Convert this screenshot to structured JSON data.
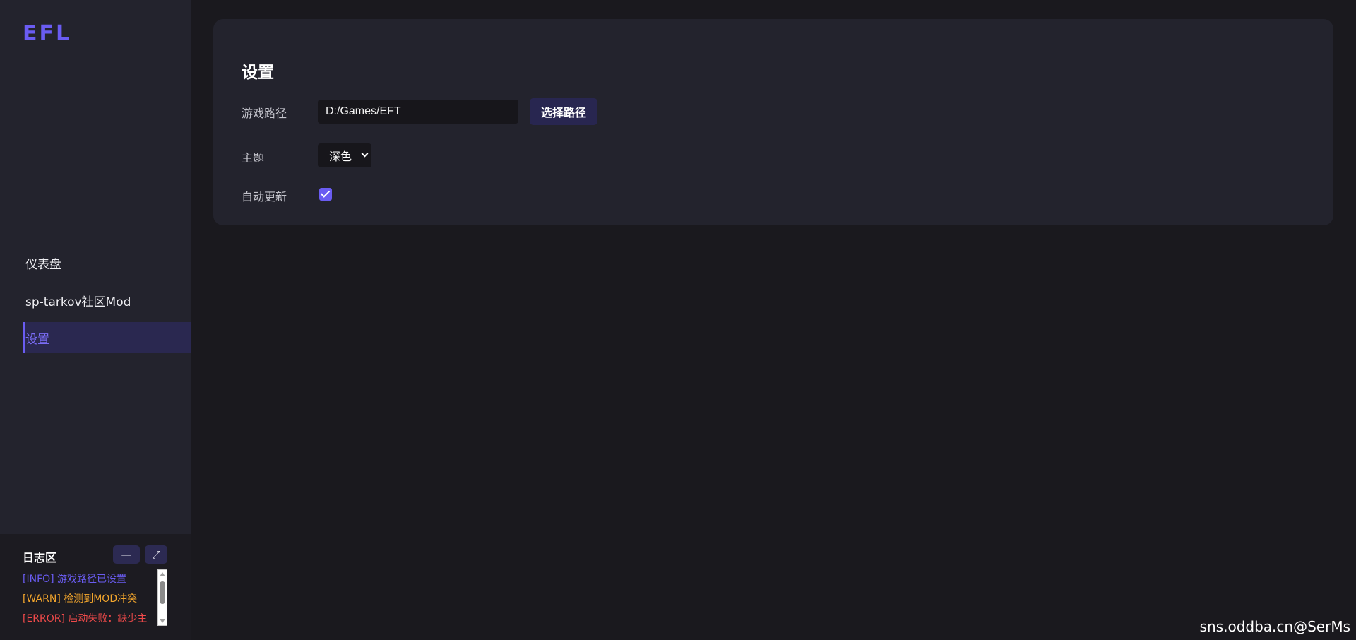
{
  "app": {
    "logo": "EFL"
  },
  "sidebar": {
    "items": [
      {
        "label": "仪表盘",
        "active": false
      },
      {
        "label": "sp-tarkov社区Mod",
        "active": false
      },
      {
        "label": "设置",
        "active": true
      }
    ]
  },
  "log": {
    "title": "日志区",
    "minimize_label": "—",
    "expand_label": "⤢",
    "lines": [
      {
        "level": "info",
        "text": "[INFO] 游戏路径已设置"
      },
      {
        "level": "warn",
        "text": "[WARN] 检测到MOD冲突"
      },
      {
        "level": "error",
        "text": "[ERROR] 启动失败：缺少主"
      }
    ]
  },
  "settings": {
    "title": "设置",
    "game_path_label": "游戏路径",
    "game_path_value": "D:/Games/EFT",
    "choose_path_label": "选择路径",
    "theme_label": "主题",
    "theme_value": "深色",
    "auto_update_label": "自动更新",
    "auto_update_checked": true
  },
  "watermark": "sns.oddba.cn@SerMs",
  "colors": {
    "accent": "#6a5cf2",
    "background": "#1a191e",
    "panel": "#23232d",
    "warn": "#f2a52c",
    "error": "#f04a4a"
  }
}
